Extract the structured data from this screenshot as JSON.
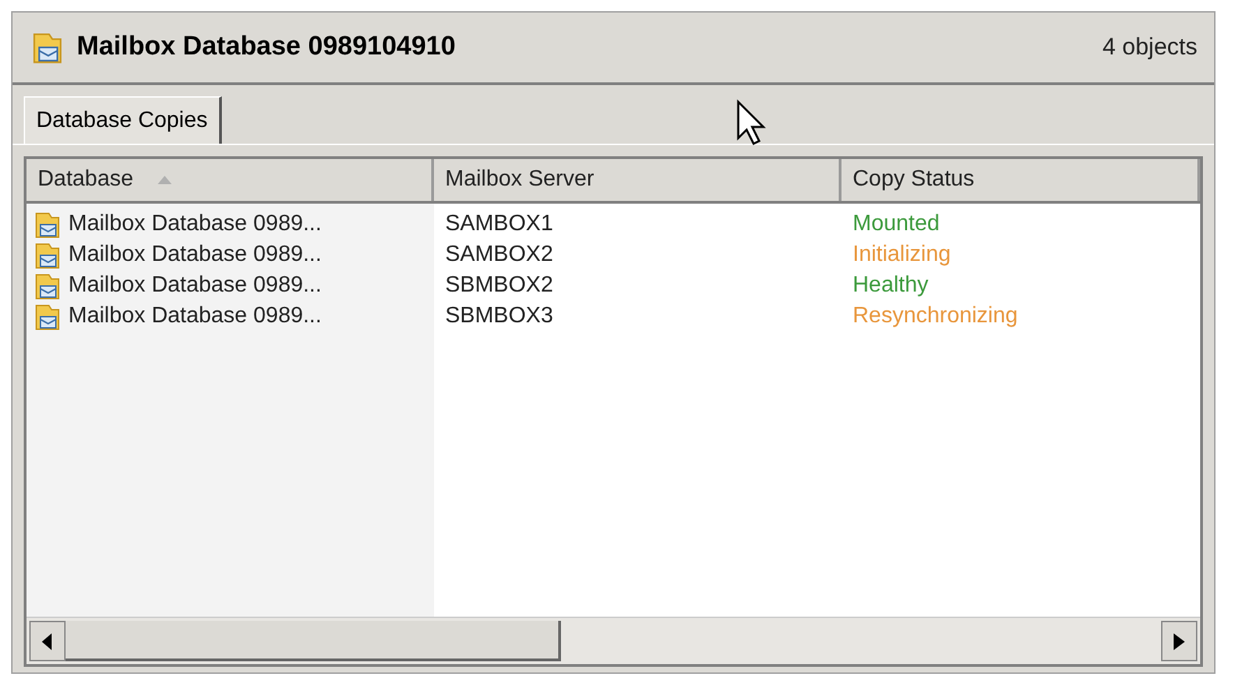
{
  "header": {
    "title": "Mailbox Database 0989104910",
    "count": "4 objects"
  },
  "tabs": [
    {
      "label": "Database Copies",
      "selected": true
    }
  ],
  "table": {
    "columns": [
      {
        "label": "Database",
        "sorted": true
      },
      {
        "label": "Mailbox Server",
        "sorted": false
      },
      {
        "label": "Copy Status",
        "sorted": false
      }
    ],
    "rows": [
      {
        "database": "Mailbox Database 0989...",
        "server": "SAMBOX1",
        "status": "Mounted",
        "color": "#3c9a3c"
      },
      {
        "database": "Mailbox Database 0989...",
        "server": "SAMBOX2",
        "status": "Initializing",
        "color": "#e8963c"
      },
      {
        "database": "Mailbox Database 0989...",
        "server": "SBMBOX2",
        "status": "Healthy",
        "color": "#3c9a3c"
      },
      {
        "database": "Mailbox Database 0989...",
        "server": "SBMBOX3",
        "status": "Resynchronizing",
        "color": "#e8963c"
      }
    ]
  }
}
